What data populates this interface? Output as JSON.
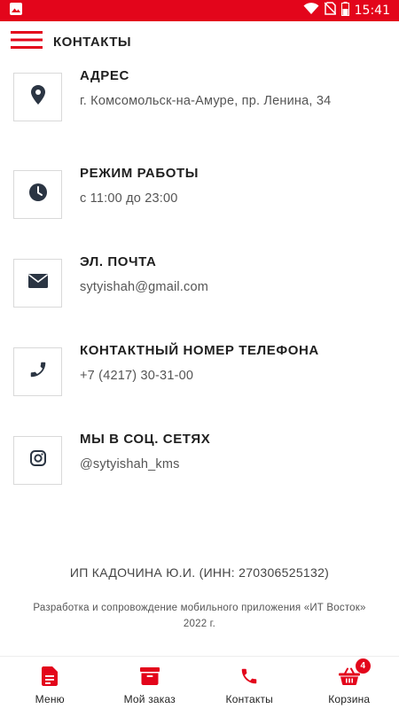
{
  "status_bar": {
    "time": "15:41",
    "icons": [
      "image-icon",
      "wifi-icon",
      "no-sim-icon",
      "battery-icon"
    ]
  },
  "header": {
    "title": "КОНТАКТЫ",
    "menu_icon": "hamburger-icon"
  },
  "contacts": [
    {
      "icon": "location-pin-icon",
      "title": "АДРЕС",
      "value": "г. Комсомольск-на-Амуре, пр. Ленина, 34"
    },
    {
      "icon": "clock-icon",
      "title": "РЕЖИМ РАБОТЫ",
      "value": "с 11:00 до 23:00"
    },
    {
      "icon": "envelope-icon",
      "title": "ЭЛ. ПОЧТА",
      "value": "sytyishah@gmail.com"
    },
    {
      "icon": "phone-icon",
      "title": "КОНТАКТНЫЙ НОМЕР ТЕЛЕФОНА",
      "value": "+7 (4217) 30-31-00"
    },
    {
      "icon": "instagram-icon",
      "title": "МЫ В СОЦ. СЕТЯХ",
      "value": "@sytyishah_kms"
    }
  ],
  "footer": {
    "legal": "ИП КАДОЧИНА Ю.И. (ИНН: 270306525132)",
    "developer": "Разработка и сопровождение мобильного приложения «ИТ Восток» 2022 г."
  },
  "bottom_nav": {
    "items": [
      {
        "label": "Меню",
        "icon": "document-icon"
      },
      {
        "label": "Мой заказ",
        "icon": "box-icon"
      },
      {
        "label": "Контакты",
        "icon": "phone-icon"
      },
      {
        "label": "Корзина",
        "icon": "basket-icon",
        "badge": "4"
      }
    ]
  },
  "colors": {
    "accent": "#e3051b",
    "icon_dark": "#2b3543"
  }
}
